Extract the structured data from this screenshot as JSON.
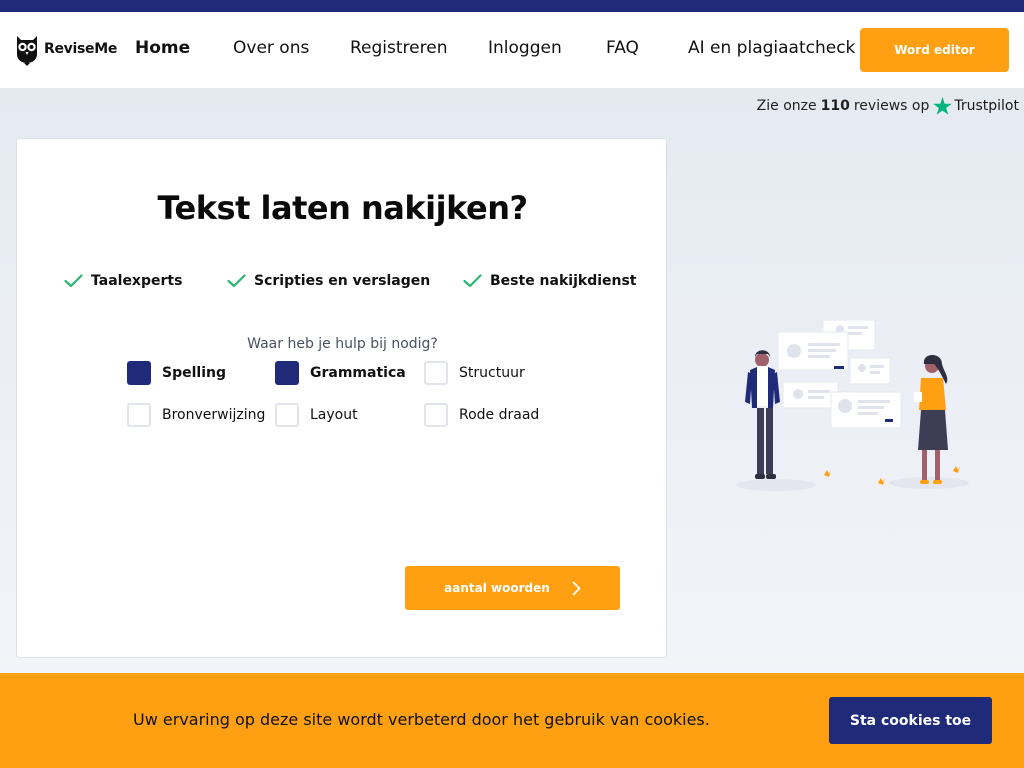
{
  "brand": {
    "name": "ReviseMe",
    "logo_icon": "owl-icon"
  },
  "nav": {
    "items": [
      {
        "label": "Home",
        "active": true
      },
      {
        "label": "Over ons"
      },
      {
        "label": "Registreren"
      },
      {
        "label": "Inloggen"
      },
      {
        "label": "FAQ"
      },
      {
        "label": "AI en plagiaatcheck"
      }
    ],
    "cta_label": "Word editor"
  },
  "trustpilot": {
    "prefix": "Zie onze",
    "count": "110",
    "suffix": "reviews op",
    "brand": "Trustpilot",
    "icon": "star-icon"
  },
  "card": {
    "title": "Tekst laten nakijken?",
    "features": [
      {
        "label": "Taalexperts",
        "icon": "check-icon"
      },
      {
        "label": "Scripties en verslagen",
        "icon": "check-icon"
      },
      {
        "label": "Beste nakijkdienst",
        "icon": "check-icon"
      }
    ],
    "question": "Waar heb je hulp bij nodig?",
    "options": [
      {
        "label": "Spelling",
        "checked": true
      },
      {
        "label": "Grammatica",
        "checked": true
      },
      {
        "label": "Structuur",
        "checked": false
      },
      {
        "label": "Bronverwijzing",
        "checked": false
      },
      {
        "label": "Layout",
        "checked": false
      },
      {
        "label": "Rode draad",
        "checked": false
      }
    ],
    "submit_label": "aantal woorden",
    "submit_icon": "chevron-right-icon"
  },
  "cookies": {
    "message": "Uw ervaring op deze site wordt verbeterd door het gebruik van cookies.",
    "accept_label": "Sta cookies toe"
  },
  "colors": {
    "accent": "#ffa012",
    "brand_navy": "#1f2a78",
    "check_green": "#2bb673",
    "trustpilot_green": "#00b67a"
  }
}
